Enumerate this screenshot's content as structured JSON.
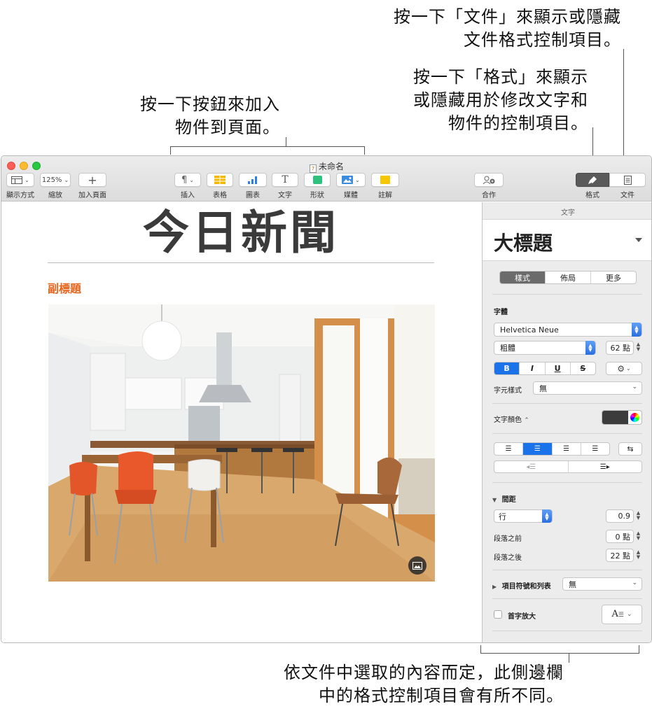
{
  "callouts": {
    "document_line1": "按一下「文件」來顯示或隱藏",
    "document_line2": "文件格式控制項目。",
    "format_line1": "按一下「格式」來顯示",
    "format_line2": "或隱藏用於修改文字和",
    "format_line3": "物件的控制項目。",
    "insert_line1": "按一下按鈕來加入",
    "insert_line2": "物件到頁面。",
    "sidebar_line1": "依文件中選取的內容而定，此側邊欄",
    "sidebar_line2": "中的格式控制項目會有所不同。"
  },
  "window": {
    "title": "未命名",
    "toolbar": {
      "view_label": "顯示方式",
      "zoom_value": "125%",
      "zoom_label": "縮放",
      "add_page_label": "加入頁面",
      "insert_label": "插入",
      "table_label": "表格",
      "chart_label": "圖表",
      "text_label": "文字",
      "shape_label": "形狀",
      "media_label": "媒體",
      "comment_label": "註解",
      "collaborate_label": "合作",
      "format_label": "格式",
      "document_label": "文件"
    }
  },
  "document": {
    "headline": "今日新聞",
    "subhead": "副標題"
  },
  "sidebar": {
    "header": "文字",
    "paragraph_style": "大標題",
    "tabs": [
      "樣式",
      "佈局",
      "更多"
    ],
    "font_section": "字體",
    "font_name": "Helvetica Neue",
    "font_weight": "粗體",
    "font_size": "62 點",
    "char_buttons": [
      "B",
      "I",
      "U",
      "S"
    ],
    "char_style_label": "字元樣式",
    "char_style_value": "無",
    "text_color_label": "文字顏色",
    "text_color": "#3c3c3c",
    "spacing_section": "間距",
    "line_label": "行",
    "line_value": "0.9",
    "before_label": "段落之前",
    "before_value": "0 點",
    "after_label": "段落之後",
    "after_value": "22 點",
    "bullets_label": "項目符號和列表",
    "bullets_value": "無",
    "dropcap_label": "首字放大"
  }
}
